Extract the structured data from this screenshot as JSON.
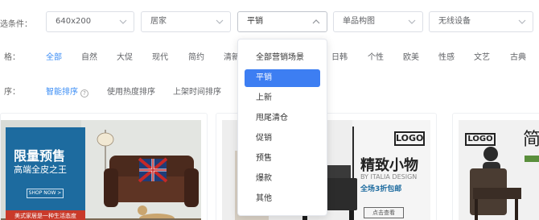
{
  "colors": {
    "accent": "#3b8df5",
    "selected_bg": "#3d7ef2",
    "banner_blue": "#1d6b9f"
  },
  "filter_label": "选条件：",
  "filters": [
    {
      "value": "640x200"
    },
    {
      "value": "居家"
    },
    {
      "value": "平销"
    },
    {
      "value": "单品构图"
    },
    {
      "value": "无线设备"
    }
  ],
  "style_label": "格：",
  "styles": [
    "全部",
    "自然",
    "大促",
    "现代",
    "简约",
    "清新",
    "日韩",
    "个性",
    "欧美",
    "性感",
    "文艺",
    "古典"
  ],
  "sort_label": "序：",
  "sorts": [
    "智能排序",
    "使用热度排序",
    "上架时间排序"
  ],
  "dropdown": {
    "options": [
      "全部营销场景",
      "平销",
      "上新",
      "甩尾清仓",
      "促销",
      "预售",
      "爆款",
      "其他"
    ],
    "selected": "平销"
  },
  "cards": {
    "c1": {
      "title": "限量预售",
      "subtitle": "高端全皮之王",
      "button": "SHOP NOW >",
      "footer": "美式家居是一种生活态度"
    },
    "c2": {
      "logo": "LOGO",
      "title": "精致小物",
      "brand": "BY ITALIA DESIGN",
      "promo": "全场3折包邮",
      "button": "点击查看"
    },
    "c3": {
      "logo": "LOGO",
      "title": "简"
    }
  }
}
